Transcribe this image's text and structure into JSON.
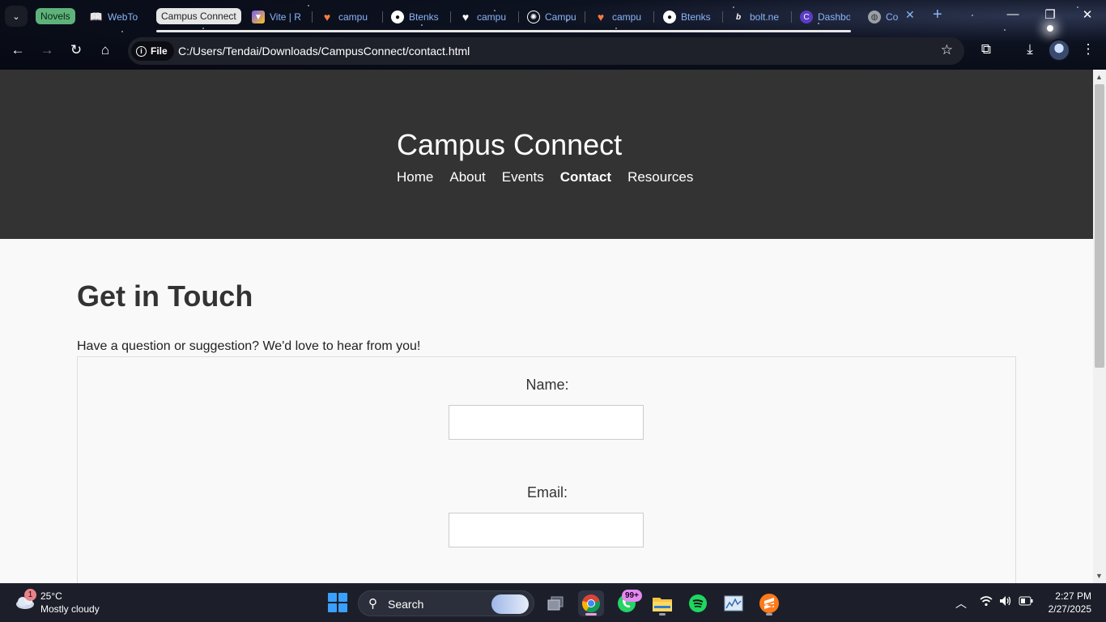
{
  "browser": {
    "tab_groups": [
      {
        "label": "Novels",
        "color": "#5eb37a"
      },
      {
        "label": "Campus Connect",
        "color": "#e6e6e6"
      }
    ],
    "tabs": [
      {
        "title": "WebTo",
        "icon": "book-icon"
      },
      {
        "title": "Vite | R",
        "icon": "vite-icon"
      },
      {
        "title": "campu",
        "icon": "heart-icon"
      },
      {
        "title": "Btenks",
        "icon": "github-icon"
      },
      {
        "title": "campu",
        "icon": "heart-icon"
      },
      {
        "title": "Campu",
        "icon": "openai-icon"
      },
      {
        "title": "campu",
        "icon": "heart-icon"
      },
      {
        "title": "Btenks",
        "icon": "github-icon"
      },
      {
        "title": "bolt.ne",
        "icon": "bolt-icon"
      },
      {
        "title": "Dashbo",
        "icon": "dashboard-icon"
      },
      {
        "title": "Co",
        "icon": "globe-icon"
      }
    ],
    "address": {
      "scheme_label": "File",
      "url": "C:/Users/Tendai/Downloads/CampusConnect/contact.html"
    }
  },
  "site": {
    "title": "Campus Connect",
    "nav": [
      {
        "label": "Home",
        "active": false
      },
      {
        "label": "About",
        "active": false
      },
      {
        "label": "Events",
        "active": false
      },
      {
        "label": "Contact",
        "active": true
      },
      {
        "label": "Resources",
        "active": false
      }
    ]
  },
  "main": {
    "heading": "Get in Touch",
    "intro": "Have a question or suggestion? We'd love to hear from you!",
    "form": {
      "name_label": "Name:",
      "name_value": "",
      "email_label": "Email:",
      "email_value": ""
    }
  },
  "taskbar": {
    "weather": {
      "badge": "1",
      "temp": "25°C",
      "condition": "Mostly cloudy"
    },
    "search_label": "Search",
    "whatsapp_badge": "99+",
    "clock": {
      "time": "2:27 PM",
      "date": "2/27/2025"
    }
  },
  "colors": {
    "header_bg": "#333333",
    "page_bg": "#f9f9f9",
    "accent_link": "#8ab4f8"
  }
}
